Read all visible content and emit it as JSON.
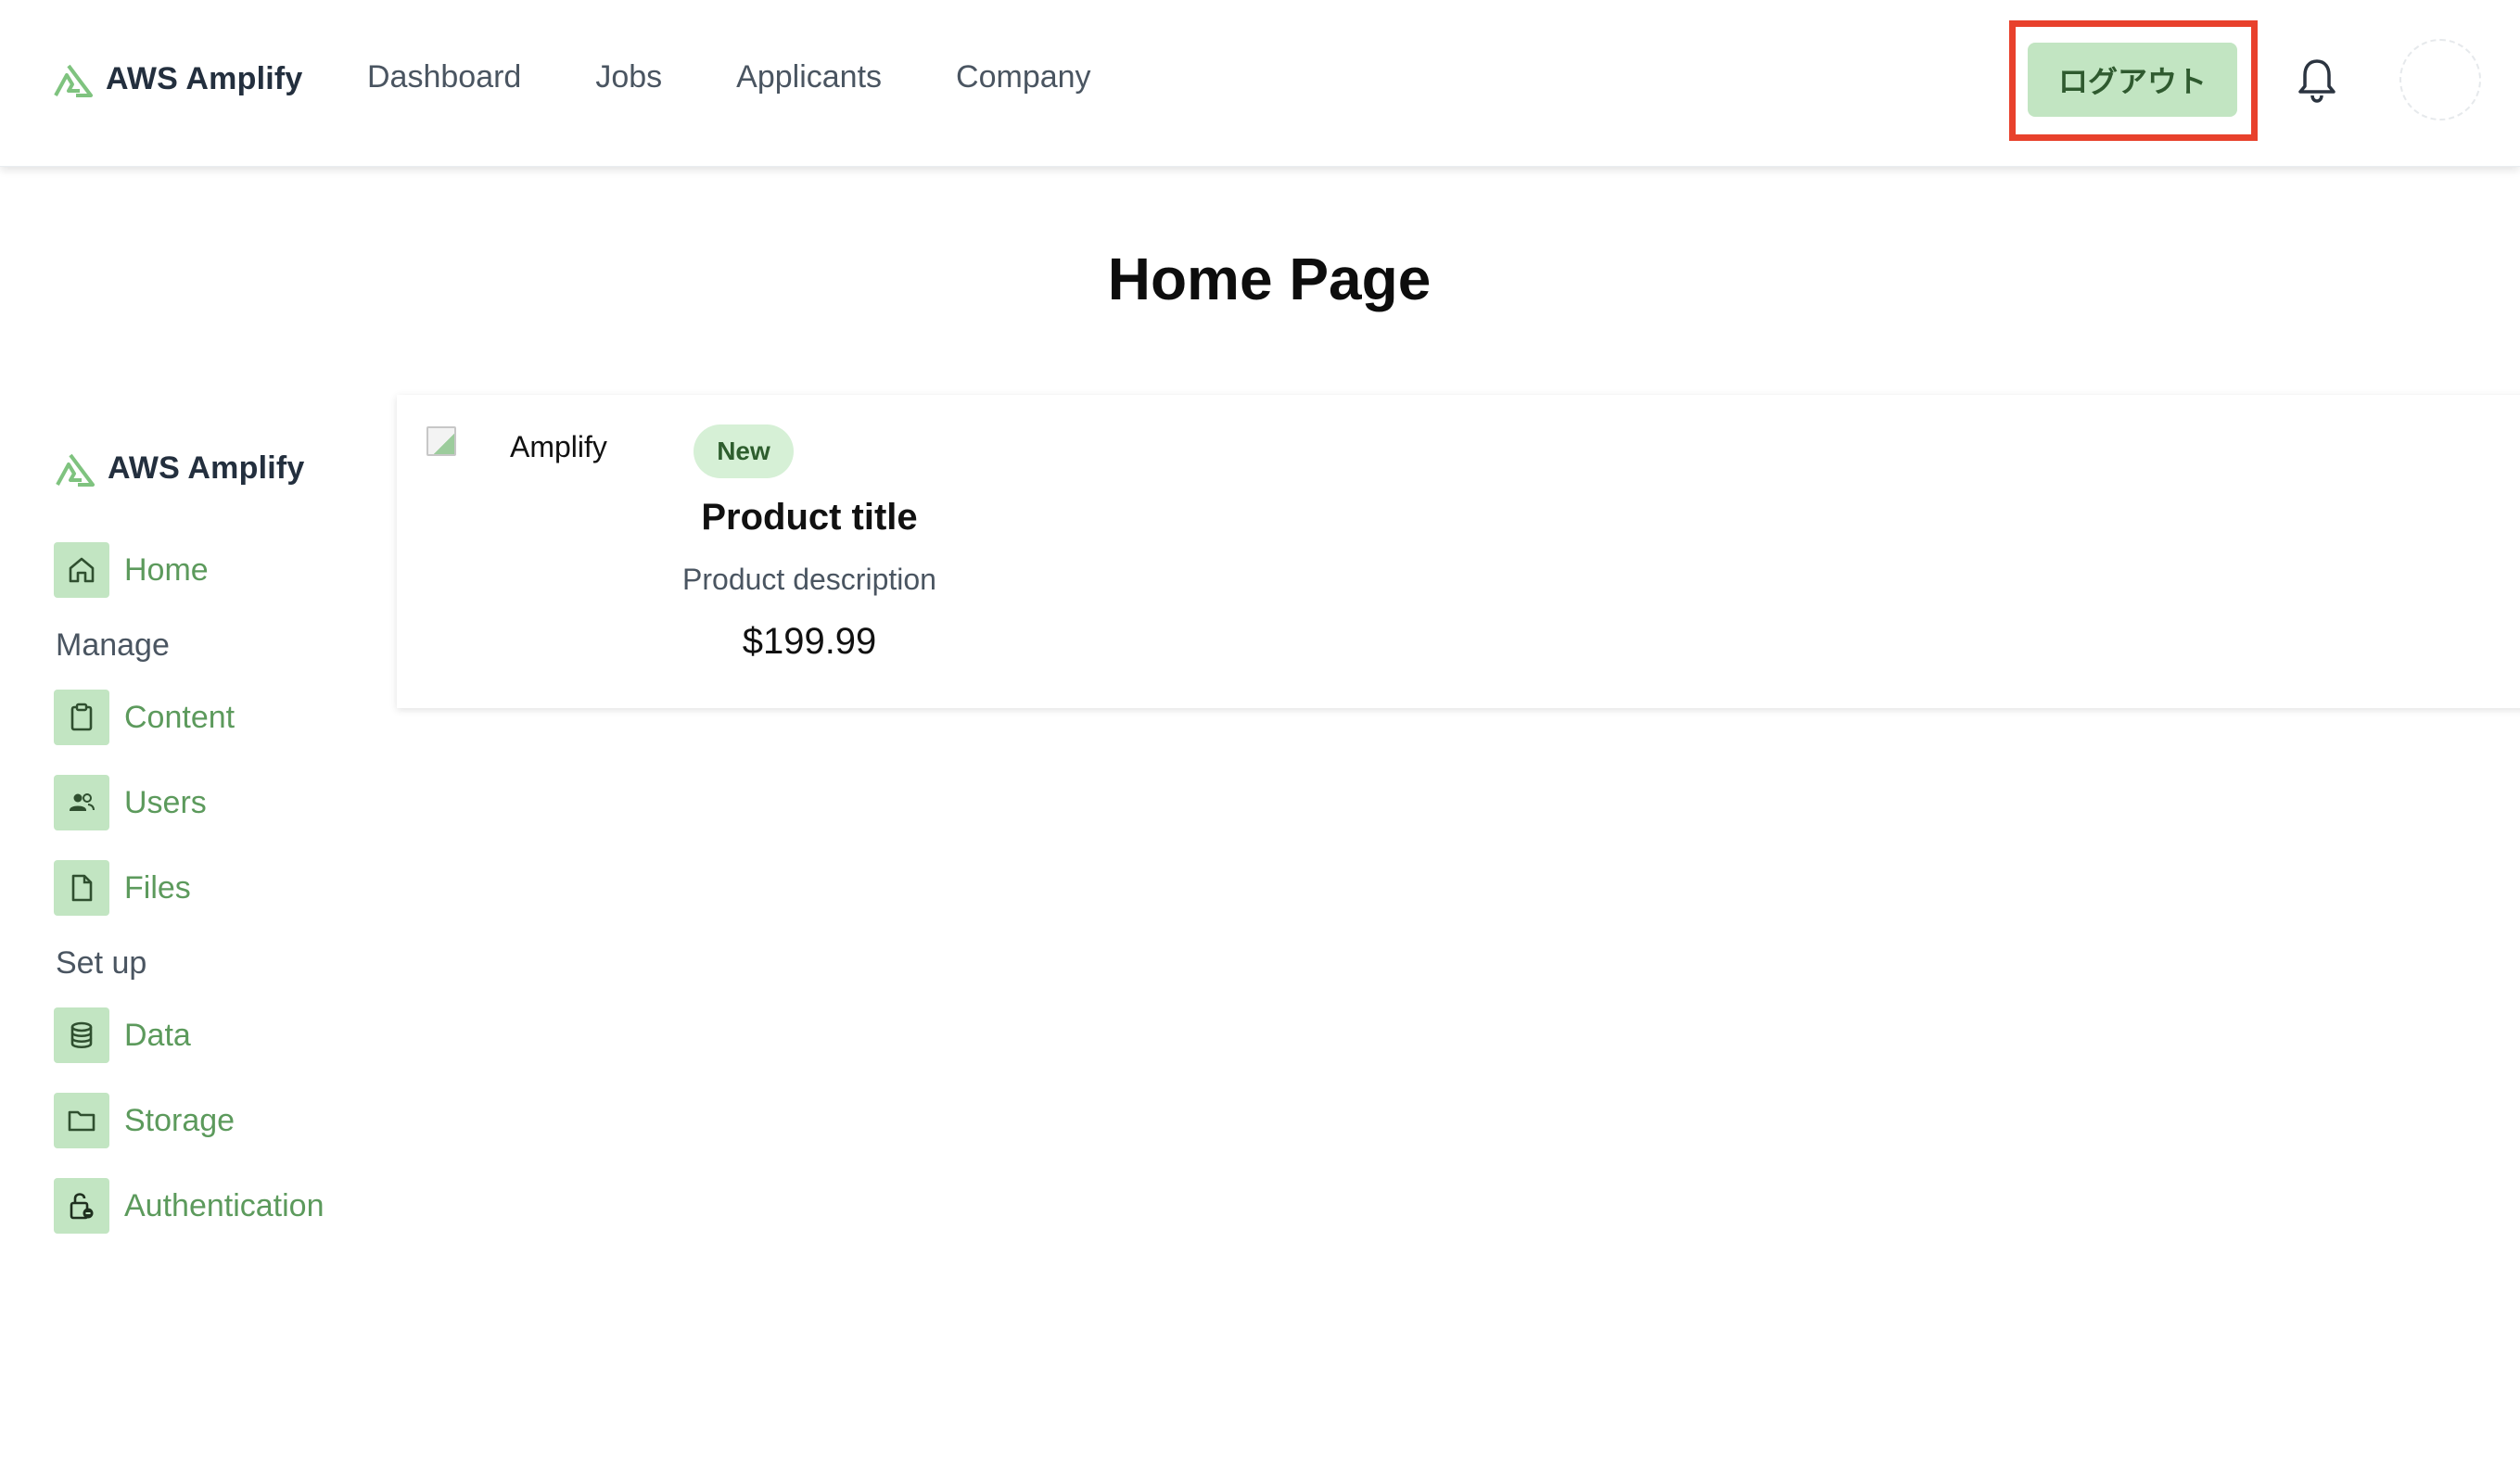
{
  "header": {
    "brand": "AWS Amplify",
    "nav": [
      "Dashboard",
      "Jobs",
      "Applicants",
      "Company"
    ],
    "logout_label": "ログアウト"
  },
  "page": {
    "title": "Home Page"
  },
  "sidebar": {
    "brand": "AWS Amplify",
    "home": {
      "label": "Home",
      "icon": "home-icon"
    },
    "sections": [
      {
        "title": "Manage",
        "items": [
          {
            "label": "Content",
            "icon": "clipboard-icon"
          },
          {
            "label": "Users",
            "icon": "users-icon"
          },
          {
            "label": "Files",
            "icon": "file-icon"
          }
        ]
      },
      {
        "title": "Set up",
        "items": [
          {
            "label": "Data",
            "icon": "database-icon"
          },
          {
            "label": "Storage",
            "icon": "folder-icon"
          },
          {
            "label": "Authentication",
            "icon": "lock-icon"
          }
        ]
      }
    ]
  },
  "product": {
    "image_alt": "Amplify",
    "badge": "New",
    "title": "Product title",
    "description": "Product description",
    "price": "$199.99"
  },
  "colors": {
    "accent": "#c2e5c2",
    "accent_text": "#5c9a5c",
    "highlight_border": "#e8412c"
  }
}
